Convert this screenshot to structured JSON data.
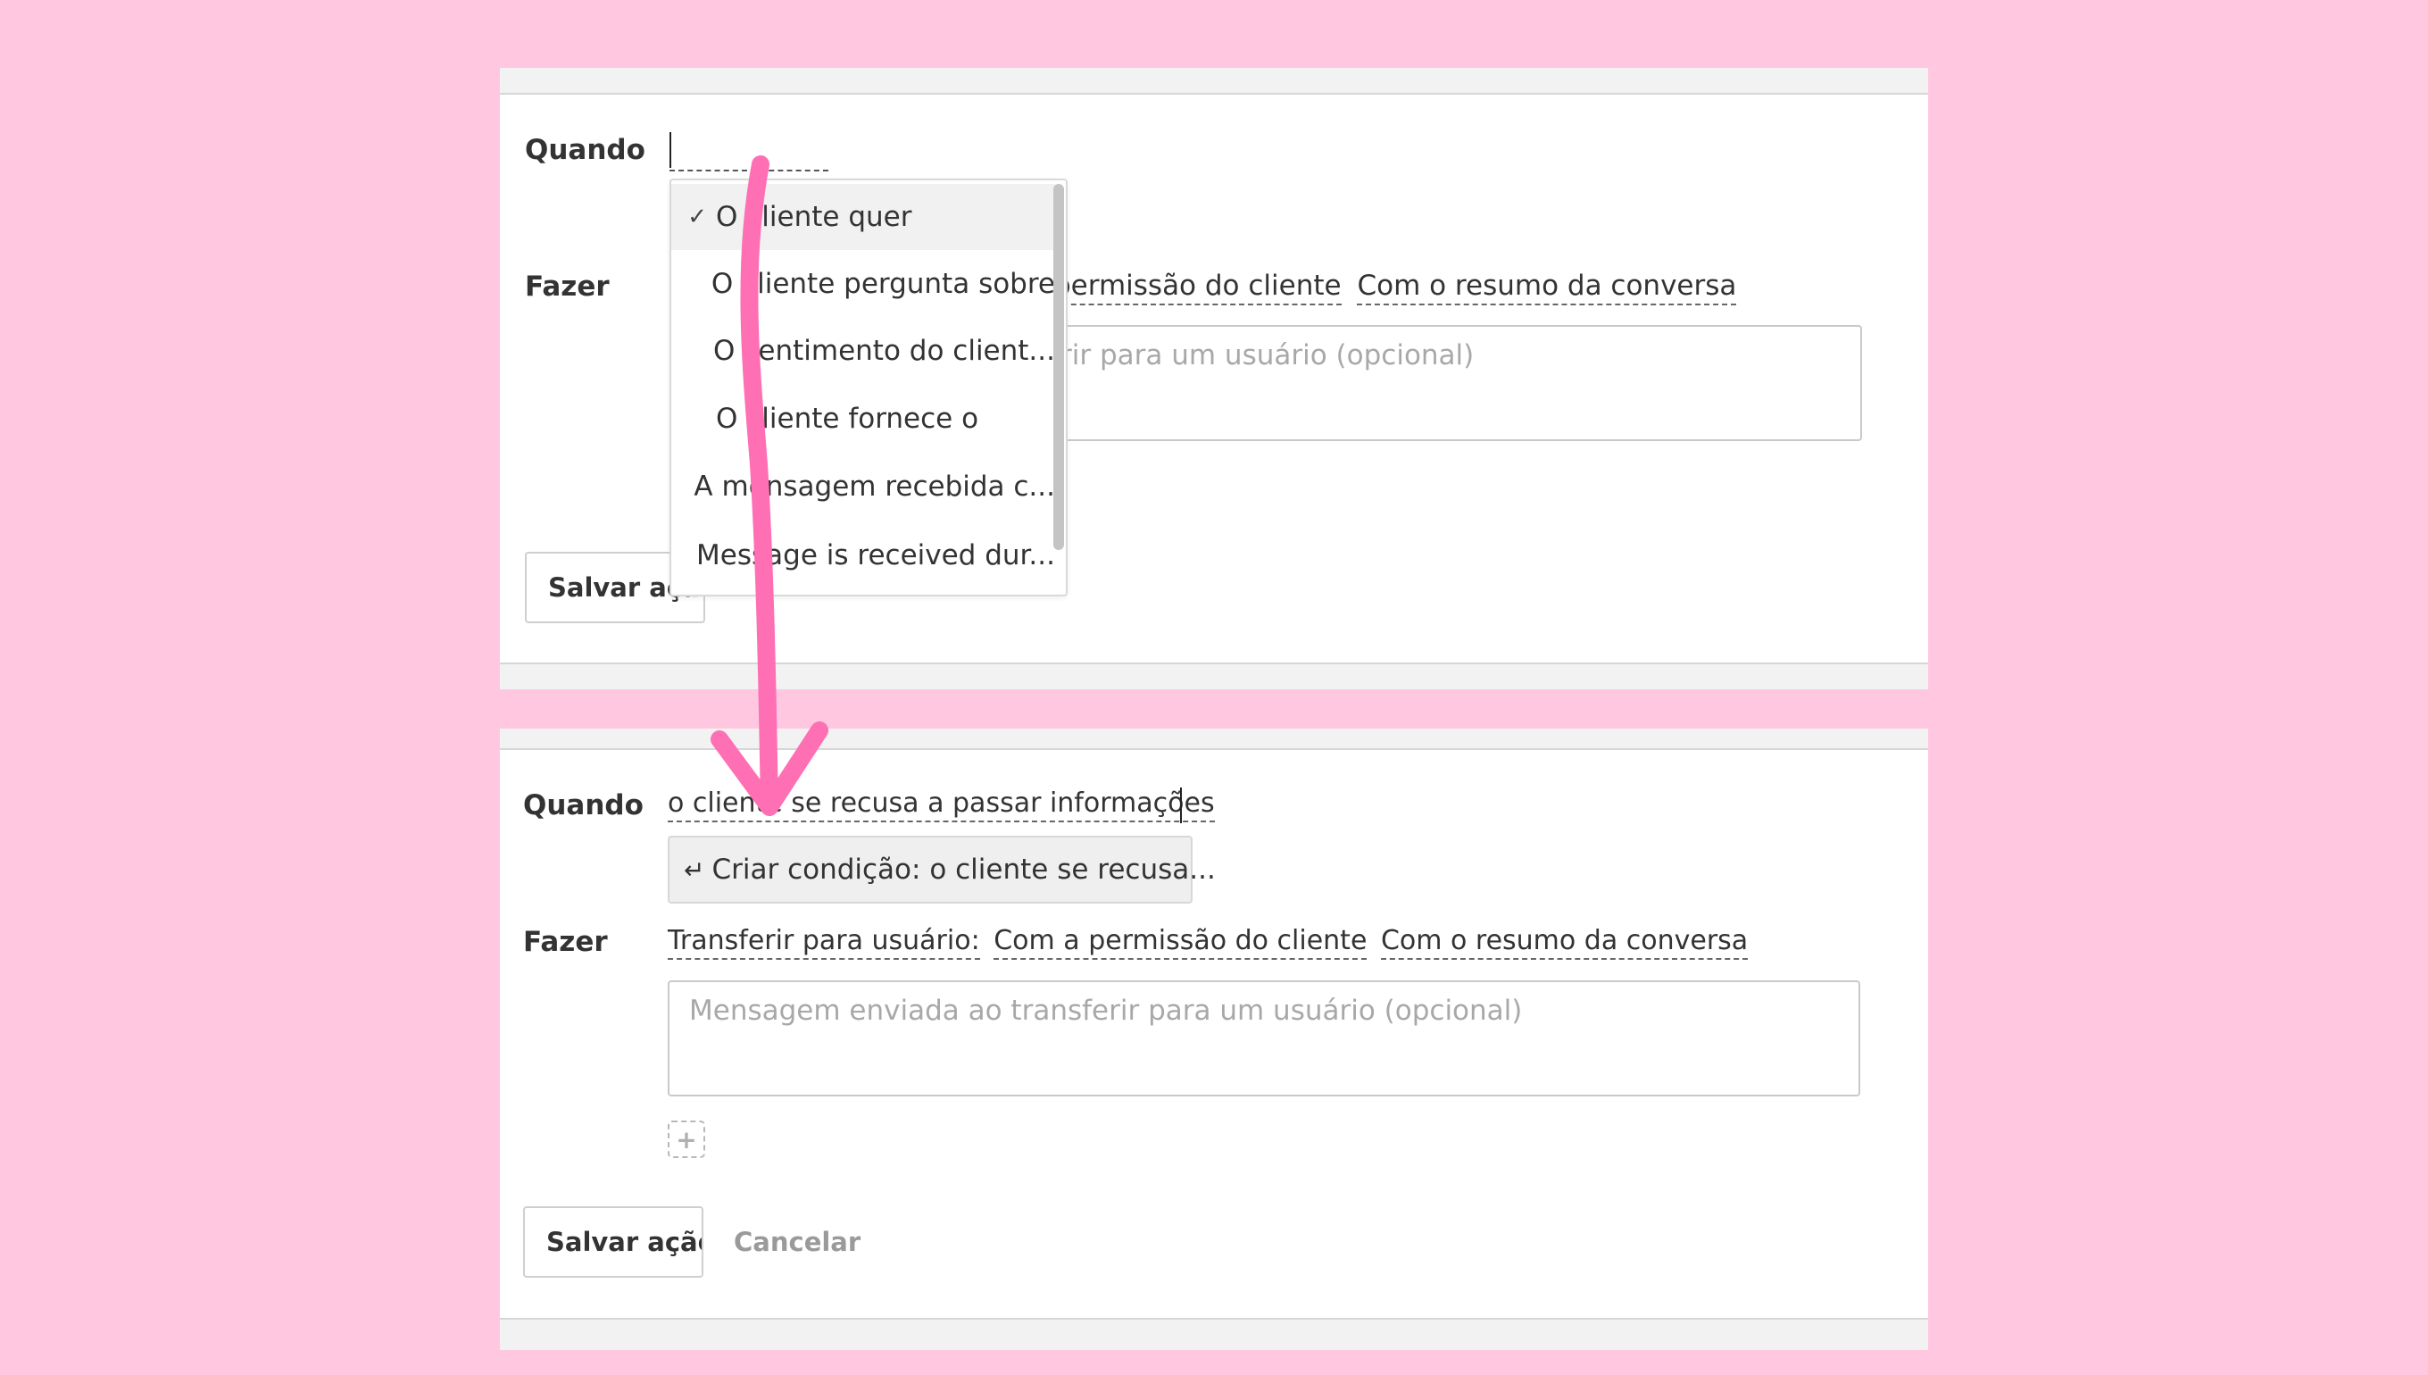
{
  "panel1": {
    "when_label": "Quando",
    "do_label": "Fazer",
    "action_tail": {
      "part1": "permissão do cliente",
      "part2": "Com o resumo da conversa"
    },
    "message_placeholder_tail": "rir para um usuário (opcional)",
    "save_button_partial": "Salvar açã",
    "dropdown": {
      "items": [
        {
          "label": "O cliente quer",
          "selected": true
        },
        {
          "label": "O cliente pergunta sobre",
          "selected": false
        },
        {
          "label": "O sentimento do client...",
          "selected": false
        },
        {
          "label": "O cliente fornece o",
          "selected": false
        },
        {
          "label": "A mensagem recebida c...",
          "selected": false
        },
        {
          "label": "Message is received dur...",
          "selected": false
        }
      ],
      "check_icon": "✓"
    }
  },
  "panel2": {
    "when_label": "Quando",
    "when_value": "o cliente se recusa a passar informações",
    "suggestion": {
      "icon": "↵",
      "label": "Criar condição: o cliente se recusa..."
    },
    "do_label": "Fazer",
    "action": {
      "part1": "Transferir para usuário:",
      "part2": "Com a permissão do cliente",
      "part3": "Com o resumo da conversa"
    },
    "message_placeholder": "Mensagem enviada ao transferir para um usuário (opcional)",
    "add_icon": "+",
    "save_label": "Salvar ação",
    "cancel_label": "Cancelar"
  },
  "colors": {
    "background": "#ffc8e0",
    "arrow": "#ff6fb4"
  }
}
